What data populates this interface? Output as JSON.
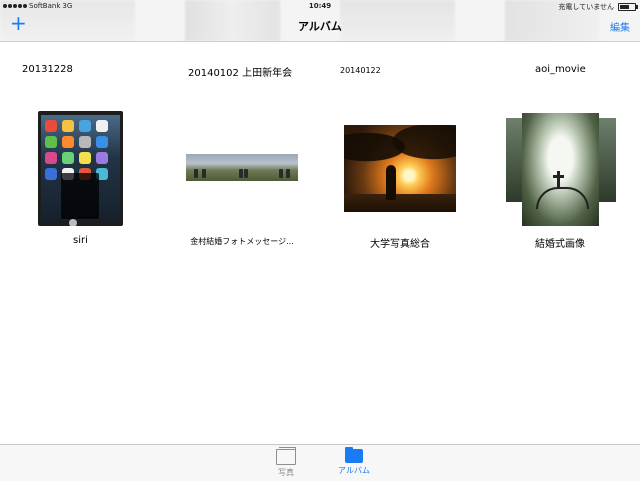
{
  "status_bar": {
    "carrier": "SoftBank",
    "network": "3G",
    "time": "10:49",
    "charging_text": "充電していません"
  },
  "nav": {
    "add_icon": "plus-icon",
    "title": "アルバム",
    "edit_label": "編集"
  },
  "top_row_labels": [
    "20131228",
    "20140102 上田新年会",
    "20140122",
    "aoi_movie"
  ],
  "albums": [
    {
      "label": "siri"
    },
    {
      "label": "金村結婚フォトメッセージ..."
    },
    {
      "label": "大学写真総合"
    },
    {
      "label": "結婚式画像"
    }
  ],
  "tabbar": {
    "photos_label": "写真",
    "albums_label": "アルバム",
    "active_color": "#1a7cf5"
  }
}
